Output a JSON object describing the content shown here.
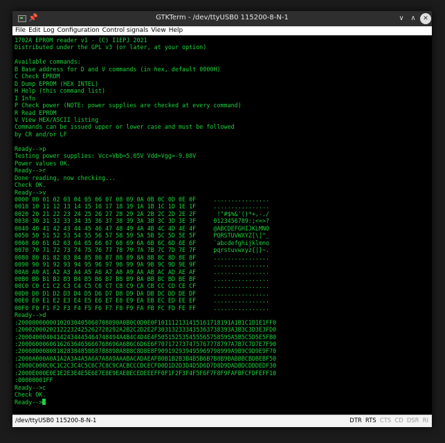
{
  "window": {
    "title": "GTKTerm - /dev/ttyUSB0 115200-8-N-1",
    "buttons": {
      "minimize": "∨",
      "maximize": "∧",
      "close": "✕"
    },
    "icons": [
      "terminal-app-icon",
      "pin-icon",
      "minimize-icon",
      "maximize-icon",
      "close-icon"
    ]
  },
  "menu": [
    {
      "label": "File"
    },
    {
      "label": "Edit"
    },
    {
      "label": "Log"
    },
    {
      "label": "Configuration"
    },
    {
      "label": "Control signals"
    },
    {
      "label": "View"
    },
    {
      "label": "Help"
    }
  ],
  "terminal": {
    "text_color": "#1ed23c",
    "background": "#000000",
    "lines": [
      "1702A EPROM reader v1 - (C) I1EPJ 2021",
      "Distributed under the GPL v3 (or later, at your option)",
      "",
      "Available commands:",
      "B Base address for D and V commands (in hex, default 0000H)",
      "C Check EPROM",
      "D Dump EPROM (HEX INTEL)",
      "H Help (this command list)",
      "I Info",
      "P Check power (NOTE: power supplies are checked at every command)",
      "R Read EPROM",
      "V View HEX/ASCII listing",
      "Commands can be issued upper or lower case and must be followed",
      "by CR and/or LF",
      "",
      "Ready-->p",
      "Testing power supplies: Vcc=Vbb=5.05V Vdd=Vgg=-9.08V",
      "Power values OK.",
      "Ready-->r",
      "Done reading, now checking...",
      "Check OK.",
      "Ready-->v",
      "0000 00 01 02 03 04 05 06 07 08 09 0A 0B 0C 0D 0E 0F     ................",
      "0010 10 11 12 13 14 15 16 17 18 19 1A 1B 1C 1D 1E 1F     ................",
      "0020 20 21 22 23 24 25 26 27 28 29 2A 2B 2C 2D 2E 2F      !\"#$%&'()*+,-./",
      "0030 30 31 32 33 34 35 36 37 38 39 3A 3B 3C 3D 3E 3F     0123456789:;<=>?",
      "0040 40 41 42 43 44 45 46 47 48 49 4A 4B 4C 4D 4E 4F     @ABCDEFGHIJKLMNO",
      "0050 50 51 52 53 54 55 56 57 58 59 5A 5B 5C 5D 5E 5F     PQRSTUVWXYZ[\\]^_",
      "0060 60 61 62 63 64 65 66 67 68 69 6A 6B 6C 6D 6E 6F     `abcdefghijklmno",
      "0070 70 71 72 73 74 75 76 77 78 79 7A 7B 7C 7D 7E 7F     pqrstuvwxyz{|}~.",
      "0080 80 81 82 83 84 85 86 87 88 89 8A 8B 8C 8D 8E 8F     ................",
      "0090 90 91 92 93 94 95 96 97 98 99 9A 9B 9C 9D 9E 9F     ................",
      "00A0 A0 A1 A2 A3 A4 A5 A6 A7 A8 A9 AA AB AC AD AE AF     ................",
      "00B0 B0 B1 B2 B3 B4 B5 B6 B7 B8 B9 BA BB BC BD BE BF     ................",
      "00C0 C0 C1 C2 C3 C4 C5 C6 C7 C8 C9 CA CB CC CD CE CF     ................",
      "00D0 D0 D1 D2 D3 D4 D5 D6 D7 D8 D9 DA DB DC DD DE DF     ................",
      "00E0 E0 E1 E2 E3 E4 E5 E6 E7 E8 E9 EA EB EC ED EE EF     ................",
      "00F0 F0 F1 F2 F3 F4 F5 F6 F7 F8 F9 FA FB FC FD FE FF     ................",
      "Ready-->d",
      ":20000000000102030405060708090A0B0C0D0E0F101112131415161718191A1B1C1D1E1FF0",
      ":20002000202122232425262728292A2B2C2D2E2F303132333435363738393A3B3C3D3E3FD0",
      ":20004000404142434445464748494A4B4C4D4E4F505152535455565758595A5B5C5D5E5FB0",
      ":20006000606162636465666768696A6B6C6D6E6F707172737475767778797A7B7C7D7E7F90",
      ":20008000808182838485868788898A8B8C8D8E8F909192939495969798999A9B9C9D9E9F70",
      ":2000A000A0A1A2A3A4A5A6A7A8A9AAABACADAEAFB0B1B2B3B4B5B6B7B8B9BABBBCBDBEBF50",
      ":2000C000C0C1C2C3C4C5C6C7C8C9CACBCCCDCECFD0D1D2D3D4D5D6D7D8D9DADBDCDDDEDF30",
      ":2000E000E0E1E2E3E4E5E6E7E8E9EAEBECEDEEEFF0F1F2F3F4F5F6F7F8F9FAFBFCFDFEFF10",
      ":00000001FF",
      "Ready-->c",
      "Check OK.",
      "Ready-->"
    ]
  },
  "statusbar": {
    "port": "/dev/ttyUSB0  115200-8-N-1",
    "signals": [
      {
        "label": "DTR",
        "active": true
      },
      {
        "label": "RTS",
        "active": true
      },
      {
        "label": "CTS",
        "active": false
      },
      {
        "label": "CD",
        "active": false
      },
      {
        "label": "DSR",
        "active": false
      },
      {
        "label": "RI",
        "active": false
      }
    ]
  }
}
